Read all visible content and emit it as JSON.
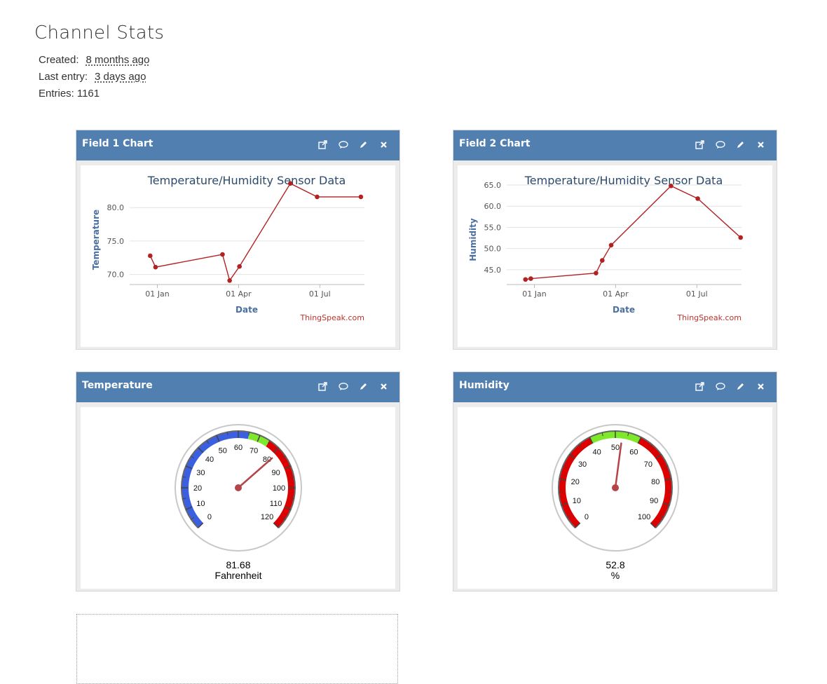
{
  "stats": {
    "title": "Channel Stats",
    "created_label": "Created:",
    "created_value": "8 months ago",
    "last_entry_label": "Last entry:",
    "last_entry_value": "3 days ago",
    "entries_label": "Entries:",
    "entries_value": "1161"
  },
  "widgets": [
    {
      "title": "Field 1 Chart"
    },
    {
      "title": "Field 2 Chart"
    },
    {
      "title": "Temperature"
    },
    {
      "title": "Humidity"
    }
  ],
  "icons": [
    "external-link-icon",
    "comment-icon",
    "pencil-icon",
    "close-icon"
  ],
  "chart_data": [
    {
      "type": "line",
      "title": "Temperature/Humidity Sensor Data",
      "xlabel": "Date",
      "ylabel": "Temperature",
      "credit": "ThingSpeak.com",
      "x_ticks": [
        "01 Jan",
        "01 Apr",
        "01 Jul"
      ],
      "y_ticks": [
        "70.0",
        "75.0",
        "80.0"
      ],
      "ylim": [
        68.5,
        84
      ],
      "series": [
        {
          "color": "#b22222",
          "points": [
            {
              "x": "2019-12-24",
              "y": 72.8
            },
            {
              "x": "2019-12-30",
              "y": 71.1
            },
            {
              "x": "2020-03-14",
              "y": 73.0
            },
            {
              "x": "2020-03-22",
              "y": 69.1
            },
            {
              "x": "2020-04-02",
              "y": 71.2
            },
            {
              "x": "2020-05-29",
              "y": 83.6
            },
            {
              "x": "2020-06-28",
              "y": 81.6
            },
            {
              "x": "2020-08-16",
              "y": 81.6
            }
          ]
        }
      ]
    },
    {
      "type": "line",
      "title": "Temperature/Humidity Sensor Data",
      "xlabel": "Date",
      "ylabel": "Humidity",
      "credit": "ThingSpeak.com",
      "x_ticks": [
        "01 Jan",
        "01 Apr",
        "01 Jul"
      ],
      "y_ticks": [
        "45.0",
        "50.0",
        "55.0",
        "60.0",
        "65.0"
      ],
      "ylim": [
        41.5,
        66
      ],
      "series": [
        {
          "color": "#b22222",
          "points": [
            {
              "x": "2019-12-22",
              "y": 42.7
            },
            {
              "x": "2019-12-28",
              "y": 42.9
            },
            {
              "x": "2020-03-10",
              "y": 44.2
            },
            {
              "x": "2020-03-17",
              "y": 47.2
            },
            {
              "x": "2020-03-27",
              "y": 50.8
            },
            {
              "x": "2020-06-02",
              "y": 64.8
            },
            {
              "x": "2020-07-02",
              "y": 61.8
            },
            {
              "x": "2020-08-19",
              "y": 52.6
            }
          ]
        }
      ]
    }
  ],
  "gauges": [
    {
      "value": 81.68,
      "value_label": "81.68",
      "units": "Fahrenheit",
      "min": 0,
      "max": 120,
      "tick_labels": [
        "0",
        "10",
        "20",
        "30",
        "40",
        "50",
        "60",
        "70",
        "80",
        "90",
        "100",
        "110",
        "120"
      ],
      "bands": [
        {
          "from": 0,
          "to": 65,
          "color": "#3a5fe0"
        },
        {
          "from": 65,
          "to": 75,
          "color": "#7ee82a"
        },
        {
          "from": 75,
          "to": 120,
          "color": "#dd0000"
        }
      ]
    },
    {
      "value": 52.8,
      "value_label": "52.8",
      "units": "%",
      "min": 0,
      "max": 100,
      "tick_labels": [
        "0",
        "10",
        "20",
        "30",
        "40",
        "50",
        "60",
        "70",
        "80",
        "90",
        "100"
      ],
      "bands": [
        {
          "from": 0,
          "to": 40,
          "color": "#dd0000"
        },
        {
          "from": 40,
          "to": 60,
          "color": "#7ee82a"
        },
        {
          "from": 60,
          "to": 100,
          "color": "#dd0000"
        }
      ]
    }
  ]
}
